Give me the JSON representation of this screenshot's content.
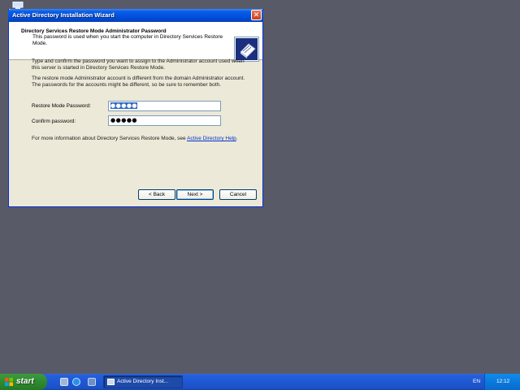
{
  "window": {
    "title": "Active Directory Installation Wizard",
    "close_glyph": "✕"
  },
  "header": {
    "title": "Directory Services Restore Mode Administrator Password",
    "subtitle": "This password is used when you start the computer in Directory Services Restore Mode.",
    "icon": "wizard-book-icon"
  },
  "body": {
    "para1": "Type and confirm the password you want to assign to the Administrator account used when this server is started in Directory Services Restore Mode.",
    "para2": "The restore mode Administrator account is different from the domain Administrator account. The passwords for the accounts might be different, so be sure to remember both.",
    "restore_label": "Restore Mode Password:",
    "restore_value": "●●●●●",
    "confirm_label": "Confirm password:",
    "confirm_value": "●●●●●",
    "info_text": "For more information about Directory Services Restore Mode, see ",
    "info_link": "Active Directory Help",
    "info_end": "."
  },
  "buttons": {
    "back": "< Back",
    "next": "Next >",
    "cancel": "Cancel"
  },
  "taskbar": {
    "start_label": "start",
    "task_item": "Active Directory Inst...",
    "language": "EN",
    "clock": "12:12"
  },
  "colors": {
    "desktop": "#585a68",
    "title_bar": "#0053e1",
    "link": "#0033cc",
    "start_green": "#2f8a2f"
  }
}
